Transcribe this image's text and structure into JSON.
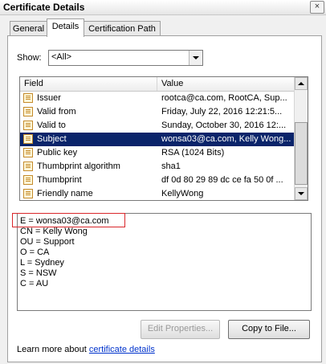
{
  "window": {
    "title": "Certificate Details",
    "close_glyph": "×"
  },
  "tabs": [
    {
      "label": "General",
      "active": false
    },
    {
      "label": "Details",
      "active": true
    },
    {
      "label": "Certification Path",
      "active": false
    }
  ],
  "show": {
    "label": "Show:",
    "value": "<All>"
  },
  "list": {
    "columns": {
      "field": "Field",
      "value": "Value"
    },
    "rows": [
      {
        "field": "Issuer",
        "value": "rootca@ca.com, RootCA, Sup...",
        "selected": false
      },
      {
        "field": "Valid from",
        "value": "Friday, July 22, 2016 12:21:5...",
        "selected": false
      },
      {
        "field": "Valid to",
        "value": "Sunday, October 30, 2016 12:...",
        "selected": false
      },
      {
        "field": "Subject",
        "value": "wonsa03@ca.com, Kelly Wong...",
        "selected": true
      },
      {
        "field": "Public key",
        "value": "RSA (1024 Bits)",
        "selected": false
      },
      {
        "field": "Thumbprint algorithm",
        "value": "sha1",
        "selected": false
      },
      {
        "field": "Thumbprint",
        "value": "df 0d 80 29 89 dc ce fa 50 0f ...",
        "selected": false
      },
      {
        "field": "Friendly name",
        "value": "KellyWong",
        "selected": false
      }
    ]
  },
  "details": {
    "lines": [
      "E = wonsa03@ca.com",
      "CN = Kelly Wong",
      "OU = Support",
      "O = CA",
      "L = Sydney",
      "S = NSW",
      "C = AU"
    ]
  },
  "buttons": {
    "edit_properties": "Edit Properties...",
    "copy_to_file": "Copy to File..."
  },
  "footer": {
    "learn_prefix": "Learn more about ",
    "learn_link": "certificate details"
  },
  "colors": {
    "selection": "#0a246a",
    "highlight_box": "#d9262b",
    "link": "#0033cc"
  }
}
